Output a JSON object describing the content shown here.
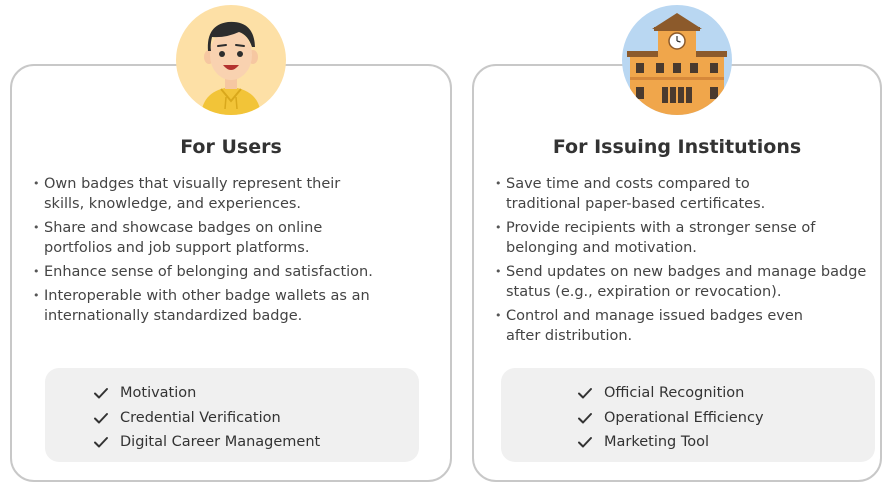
{
  "users": {
    "title": "For Users",
    "bullets": [
      "Own badges that visually represent their skills, knowledge, and experiences.",
      "Share and showcase badges on online portfolios and job support platforms.",
      "Enhance sense of belonging and satisfaction.",
      "Interoperable with other badge wallets as an internationally standardized badge."
    ],
    "benefits": [
      "Motivation",
      "Credential Verification",
      "Digital Career Management"
    ]
  },
  "institutions": {
    "title": "For Issuing Institutions",
    "bullets": [
      "Save time and costs compared to traditional paper-based certificates.",
      "Provide recipients with a stronger sense of belonging and motivation.",
      "Send updates on new badges and manage badge status (e.g., expiration or revocation).",
      "Control and manage issued badges even after distribution."
    ],
    "benefits": [
      "Official Recognition",
      "Operational Efficiency",
      "Marketing Tool"
    ]
  },
  "colors": {
    "border": "#c8c8c8",
    "benefit_bg": "#f0f0f0",
    "avatar_user_bg": "#fde0a6",
    "avatar_inst_bg": "#b9d7f2"
  },
  "icons": {
    "benefit": "check-icon",
    "user_avatar": "user-avatar-icon",
    "institution_avatar": "school-building-icon"
  }
}
